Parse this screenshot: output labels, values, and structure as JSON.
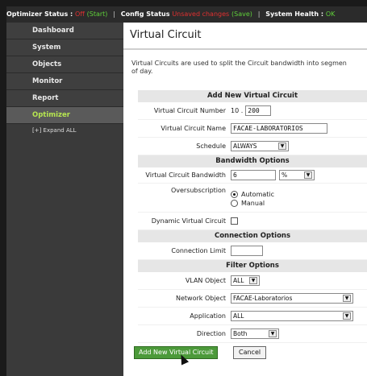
{
  "topbar": {
    "optimizer_status_label": "Optimizer Status :",
    "optimizer_status_value": "Off",
    "optimizer_status_start": "(Start)",
    "config_status_label": "Config Status",
    "config_status_value": "Unsaved changes",
    "config_status_save": "(Save)",
    "health_label": "System Health :",
    "health_value": "OK"
  },
  "sidebar": {
    "items": [
      {
        "label": "Dashboard"
      },
      {
        "label": "System"
      },
      {
        "label": "Objects"
      },
      {
        "label": "Monitor"
      },
      {
        "label": "Report"
      },
      {
        "label": "Optimizer"
      }
    ],
    "expand_all": "[+] Expand ALL",
    "active_color": "#b6e650"
  },
  "main": {
    "title": "Virtual Circuit",
    "intro_line1": "Virtual Circuits are used to split the Circuit bandwidth into segmen",
    "intro_line2": "of day."
  },
  "form": {
    "sections": {
      "add_new": "Add New Virtual Circuit",
      "bandwidth": "Bandwidth Options",
      "connection": "Connection Options",
      "filter": "Filter Options"
    },
    "vc_number": {
      "label": "Virtual Circuit Number",
      "prefix": "10 .",
      "value": "200"
    },
    "vc_name": {
      "label": "Virtual Circuit Name",
      "value": "FACAE-LABORATORIOS"
    },
    "schedule": {
      "label": "Schedule",
      "value": "ALWAYS"
    },
    "bandwidth": {
      "label": "Virtual Circuit Bandwidth",
      "value": "6",
      "unit": "%"
    },
    "oversubscription": {
      "label": "Oversubscription",
      "opt1": "Automatic",
      "opt2": "Manual",
      "selected": "Automatic"
    },
    "dynamic": {
      "label": "Dynamic Virtual Circuit",
      "checked": false
    },
    "conn_limit": {
      "label": "Connection Limit",
      "value": ""
    },
    "vlan": {
      "label": "VLAN Object",
      "value": "ALL"
    },
    "network": {
      "label": "Network Object",
      "value": "FACAE-Laboratorios"
    },
    "application": {
      "label": "Application",
      "value": "ALL"
    },
    "direction": {
      "label": "Direction",
      "value": "Both"
    }
  },
  "buttons": {
    "add": "Add New Virtual Circuit",
    "cancel": "Cancel"
  },
  "icons": {
    "dropdown": "chevron-down-icon",
    "cursor": "mouse-pointer-icon"
  }
}
